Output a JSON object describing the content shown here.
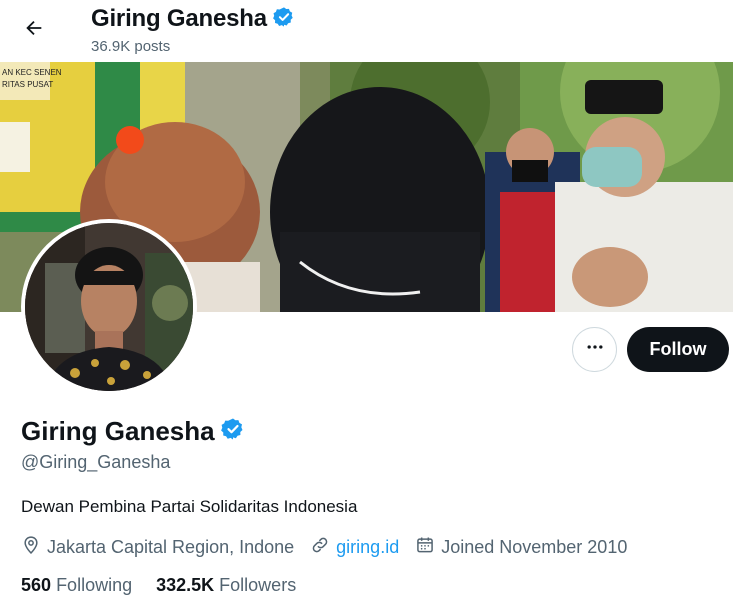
{
  "header": {
    "name": "Giring Ganesha",
    "posts_count": "36.9K posts"
  },
  "profile": {
    "name": "Giring Ganesha",
    "handle": "@Giring_Ganesha",
    "bio": "Dewan Pembina Partai Solidaritas Indonesia",
    "location": "Jakarta Capital Region, Indone",
    "website": "giring.id",
    "joined": "Joined November 2010",
    "verified": true
  },
  "actions": {
    "follow_label": "Follow"
  },
  "stats": {
    "following_count": "560",
    "following_label": "Following",
    "followers_count": "332.5K",
    "followers_label": "Followers"
  },
  "banner_sign": {
    "line1": "AN KEC SENEN",
    "line2": "RITAS PUSAT"
  },
  "colors": {
    "verified": "#1d9bf0",
    "follow_button": "#0f1419",
    "link": "#1d9bf0",
    "muted_text": "#536471"
  },
  "icons": {
    "back": "arrow-left-icon",
    "verified": "verified-badge-icon",
    "more": "more-horizontal-icon",
    "location": "location-pin-icon",
    "link": "link-icon",
    "calendar": "calendar-icon"
  }
}
